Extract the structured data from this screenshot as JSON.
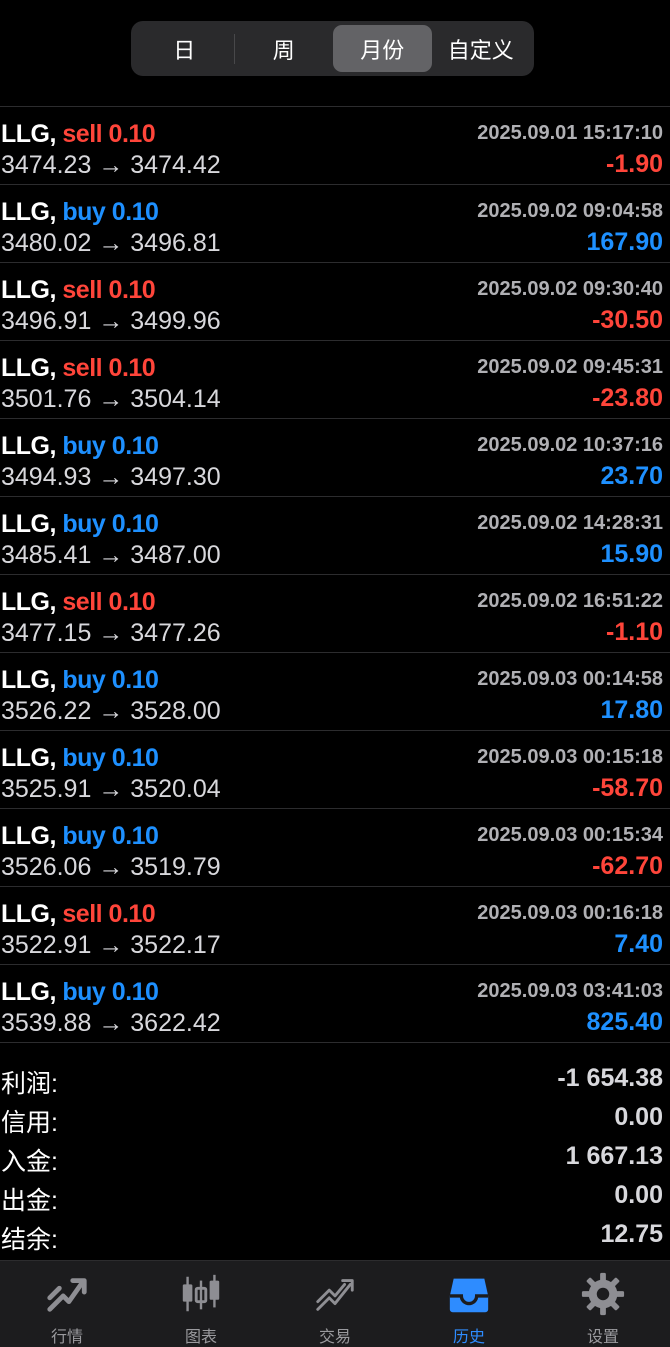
{
  "segments": [
    {
      "label": "日",
      "active": false
    },
    {
      "label": "周",
      "active": false
    },
    {
      "label": "月份",
      "active": true
    },
    {
      "label": "自定义",
      "active": false
    }
  ],
  "deals": [
    {
      "symbol": "LLG,",
      "side": "sell",
      "volume": "0.10",
      "time": "2025.09.01 15:17:10",
      "prices": "3474.23 → 3474.42",
      "profit": "-1.90"
    },
    {
      "symbol": "LLG,",
      "side": "buy",
      "volume": "0.10",
      "time": "2025.09.02 09:04:58",
      "prices": "3480.02 → 3496.81",
      "profit": "167.90"
    },
    {
      "symbol": "LLG,",
      "side": "sell",
      "volume": "0.10",
      "time": "2025.09.02 09:30:40",
      "prices": "3496.91 → 3499.96",
      "profit": "-30.50"
    },
    {
      "symbol": "LLG,",
      "side": "sell",
      "volume": "0.10",
      "time": "2025.09.02 09:45:31",
      "prices": "3501.76 → 3504.14",
      "profit": "-23.80"
    },
    {
      "symbol": "LLG,",
      "side": "buy",
      "volume": "0.10",
      "time": "2025.09.02 10:37:16",
      "prices": "3494.93 → 3497.30",
      "profit": "23.70"
    },
    {
      "symbol": "LLG,",
      "side": "buy",
      "volume": "0.10",
      "time": "2025.09.02 14:28:31",
      "prices": "3485.41 → 3487.00",
      "profit": "15.90"
    },
    {
      "symbol": "LLG,",
      "side": "sell",
      "volume": "0.10",
      "time": "2025.09.02 16:51:22",
      "prices": "3477.15 → 3477.26",
      "profit": "-1.10"
    },
    {
      "symbol": "LLG,",
      "side": "buy",
      "volume": "0.10",
      "time": "2025.09.03 00:14:58",
      "prices": "3526.22 → 3528.00",
      "profit": "17.80"
    },
    {
      "symbol": "LLG,",
      "side": "buy",
      "volume": "0.10",
      "time": "2025.09.03 00:15:18",
      "prices": "3525.91 → 3520.04",
      "profit": "-58.70"
    },
    {
      "symbol": "LLG,",
      "side": "buy",
      "volume": "0.10",
      "time": "2025.09.03 00:15:34",
      "prices": "3526.06 → 3519.79",
      "profit": "-62.70"
    },
    {
      "symbol": "LLG,",
      "side": "sell",
      "volume": "0.10",
      "time": "2025.09.03 00:16:18",
      "prices": "3522.91 → 3522.17",
      "profit": "7.40"
    },
    {
      "symbol": "LLG,",
      "side": "buy",
      "volume": "0.10",
      "time": "2025.09.03 03:41:03",
      "prices": "3539.88 → 3622.42",
      "profit": "825.40"
    }
  ],
  "summary": [
    {
      "label": "利润:",
      "value": "-1 654.38"
    },
    {
      "label": "信用:",
      "value": "0.00"
    },
    {
      "label": "入金:",
      "value": "1 667.13"
    },
    {
      "label": "出金:",
      "value": "0.00"
    },
    {
      "label": "结余:",
      "value": "12.75"
    }
  ],
  "tabs": [
    {
      "label": "行情",
      "icon": "quotes-icon",
      "active": false
    },
    {
      "label": "图表",
      "icon": "chart-icon",
      "active": false
    },
    {
      "label": "交易",
      "icon": "trade-icon",
      "active": false
    },
    {
      "label": "历史",
      "icon": "history-icon",
      "active": true
    },
    {
      "label": "设置",
      "icon": "settings-icon",
      "active": false
    }
  ],
  "colors": {
    "buy": "#1e90ff",
    "sell": "#ff453a",
    "active_tab": "#2e8cff"
  }
}
